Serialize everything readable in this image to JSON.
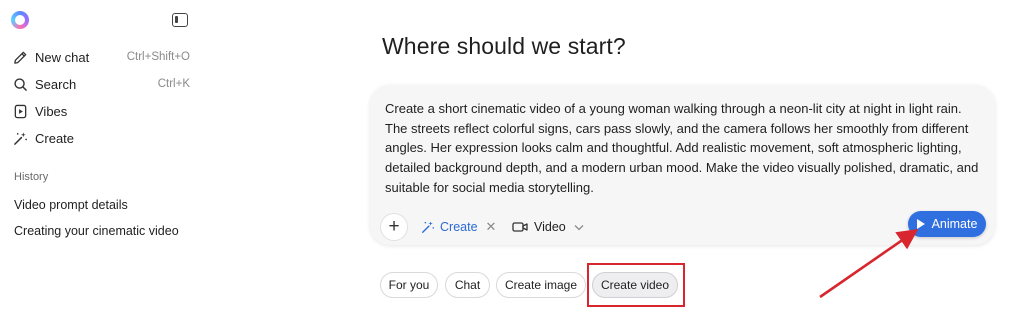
{
  "sidebar": {
    "nav": [
      {
        "label": "New chat",
        "shortcut": "Ctrl+Shift+O",
        "icon": "edit-icon"
      },
      {
        "label": "Search",
        "shortcut": "Ctrl+K",
        "icon": "search-icon"
      },
      {
        "label": "Vibes",
        "shortcut": "",
        "icon": "play-square-icon"
      },
      {
        "label": "Create",
        "shortcut": "",
        "icon": "magic-wand-icon"
      }
    ],
    "history_heading": "History",
    "history": [
      "Video prompt details",
      "Creating your cinematic video"
    ]
  },
  "main": {
    "title": "Where should we start?",
    "composer": {
      "prompt": "Create a short cinematic video of a young woman walking through a neon-lit city at night in light rain. The streets reflect colorful signs, cars pass slowly, and the camera follows her smoothly from different angles. Her expression looks calm and thoughtful. Add realistic movement, soft atmospheric lighting, detailed background depth, and a modern urban mood. Make the video visually polished, dramatic, and suitable for social media storytelling.",
      "plus": "+",
      "create_chip": "Create",
      "video_chip": "Video",
      "animate_label": "Animate"
    },
    "suggestions": [
      "For you",
      "Chat",
      "Create image",
      "Create video"
    ]
  },
  "colors": {
    "accent": "#2f6fe0",
    "annotation_red": "#d7262e"
  }
}
